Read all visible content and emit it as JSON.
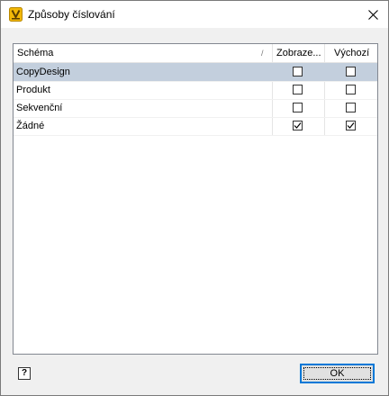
{
  "window": {
    "title": "Způsoby číslování"
  },
  "columns": {
    "schema": "Schéma",
    "sort_glyph": "/",
    "display": "Zobraze...",
    "default": "Výchozí"
  },
  "rows": [
    {
      "label": "CopyDesign",
      "display": false,
      "default": false,
      "selected": true
    },
    {
      "label": "Produkt",
      "display": false,
      "default": false,
      "selected": false
    },
    {
      "label": "Sekvenční",
      "display": false,
      "default": false,
      "selected": false
    },
    {
      "label": "Žádné",
      "display": true,
      "default": true,
      "selected": false
    }
  ],
  "buttons": {
    "help": "?",
    "ok": "OK"
  },
  "colors": {
    "selection": "#c3cfdd",
    "accent": "#0078d7",
    "icon_gold": "#f2b807"
  }
}
